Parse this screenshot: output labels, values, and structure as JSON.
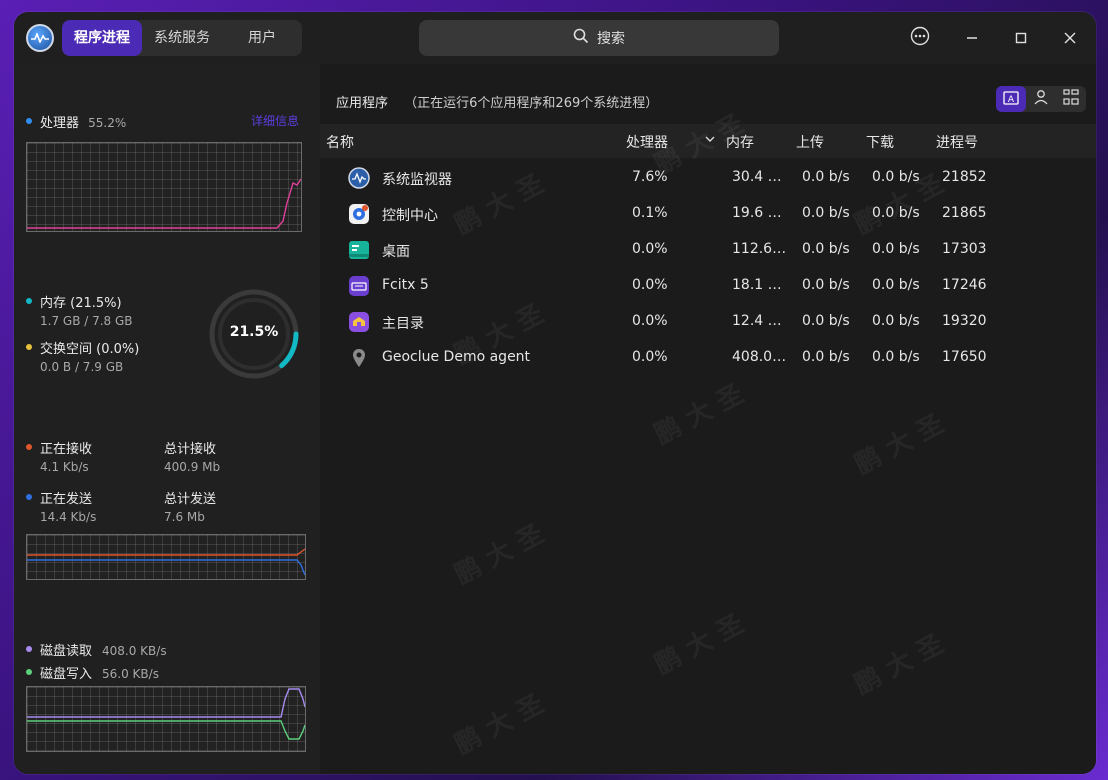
{
  "tabs": [
    "程序进程",
    "系统服务",
    "用户"
  ],
  "search": {
    "label": "搜索"
  },
  "cpu": {
    "label": "处理器",
    "value": "55.2%",
    "details_link": "详细信息"
  },
  "memory": {
    "label": "内存 (21.5%)",
    "detail": "1.7 GB / 7.8 GB",
    "ring_value": "21.5%",
    "ring_fraction": 0.215
  },
  "swap": {
    "label": "交换空间 (0.0%)",
    "detail": "0.0 B / 7.9 GB"
  },
  "network": {
    "recv_label": "正在接收",
    "recv_value": "4.1 Kb/s",
    "total_recv_label": "总计接收",
    "total_recv_value": "400.9 Mb",
    "send_label": "正在发送",
    "send_value": "14.4 Kb/s",
    "total_send_label": "总计发送",
    "total_send_value": "7.6 Mb"
  },
  "disk": {
    "read_label": "磁盘读取",
    "read_value": "408.0 KB/s",
    "write_label": "磁盘写入",
    "write_value": "56.0 KB/s"
  },
  "apps_header": {
    "title": "应用程序",
    "summary": "（正在运行6个应用程序和269个系统进程）"
  },
  "columns": [
    "名称",
    "处理器",
    "内存",
    "上传",
    "下载",
    "进程号"
  ],
  "processes": [
    {
      "name": "系统监视器",
      "cpu": "7.6%",
      "mem": "30.4 …",
      "up": "0.0 b/s",
      "down": "0.0 b/s",
      "pid": "21852",
      "icon": "monitor-icon"
    },
    {
      "name": "控制中心",
      "cpu": "0.1%",
      "mem": "19.6 …",
      "up": "0.0 b/s",
      "down": "0.0 b/s",
      "pid": "21865",
      "icon": "control-center-icon"
    },
    {
      "name": "桌面",
      "cpu": "0.0%",
      "mem": "112.6…",
      "up": "0.0 b/s",
      "down": "0.0 b/s",
      "pid": "17303",
      "icon": "desktop-icon"
    },
    {
      "name": "Fcitx 5",
      "cpu": "0.0%",
      "mem": "18.1 …",
      "up": "0.0 b/s",
      "down": "0.0 b/s",
      "pid": "17246",
      "icon": "keyboard-icon"
    },
    {
      "name": "主目录",
      "cpu": "0.0%",
      "mem": "12.4 …",
      "up": "0.0 b/s",
      "down": "0.0 b/s",
      "pid": "19320",
      "icon": "home-folder-icon"
    },
    {
      "name": "Geoclue Demo agent",
      "cpu": "0.0%",
      "mem": "408.0…",
      "up": "0.0 b/s",
      "down": "0.0 b/s",
      "pid": "17650",
      "icon": "location-pin-icon"
    }
  ],
  "colors": {
    "accent": "#4b2bb5",
    "cpu_line": "#e0409a",
    "recv": "#e0552a",
    "send": "#2f6fe0",
    "disk_read": "#a88bf0",
    "disk_write": "#5ccf7a",
    "ring": "#12b8c4",
    "swap": "#e8c23a"
  }
}
